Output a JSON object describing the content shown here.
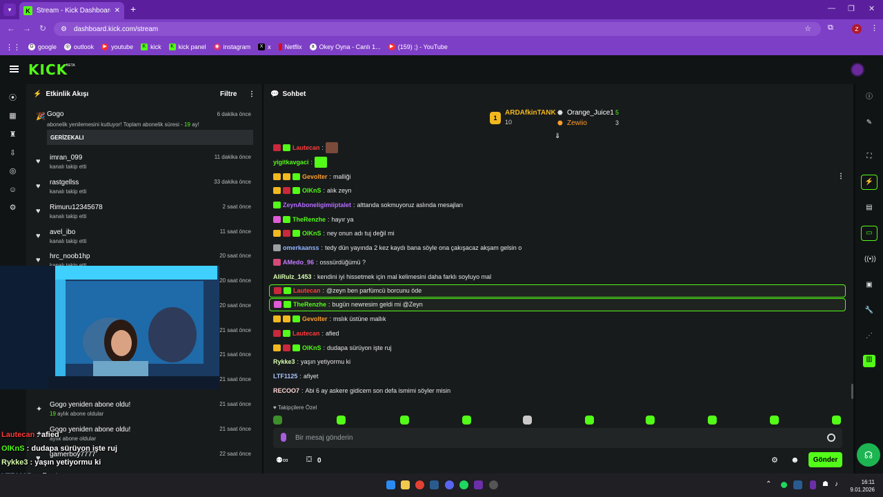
{
  "browser": {
    "tab_title": "Stream - Kick Dashboard",
    "url": "dashboard.kick.com/stream",
    "profile_initial": "Z",
    "bookmarks": [
      "google",
      "outlook",
      "youtube",
      "kick",
      "kick panel",
      "instagram",
      "x",
      "Netflix",
      "Okey Oyna - Canlı 1...",
      "(159) ;) - YouTube"
    ]
  },
  "kick": {
    "logo": "KICK",
    "beta": "BETA"
  },
  "feed": {
    "title": "Etkinlik Akışı",
    "filter": "Filtre",
    "sub_event": {
      "name": "Gogo",
      "time": "6 dakika önce",
      "text_pre": "abonelik yenilemesini kutluyor! Toplam abonelik süresi - ",
      "months": "19",
      "text_post": " ay!",
      "message": "GERİZEKALI"
    },
    "items": [
      {
        "name": "imran_099",
        "sub": "kanalı takip etti",
        "time": "11 dakika önce"
      },
      {
        "name": "rastgellss",
        "sub": "kanalı takip etti",
        "time": "33 dakika önce"
      },
      {
        "name": "Rimuru12345678",
        "sub": "kanalı takip etti",
        "time": "2 saat önce"
      },
      {
        "name": "avel_ibo",
        "sub": "kanalı takip etti",
        "time": "11 saat önce"
      },
      {
        "name": "hrc_noob1hp",
        "sub": "kanalı takip etti",
        "time": "20 saat önce"
      },
      {
        "name": "",
        "sub": "",
        "time": "20 saat önce"
      },
      {
        "name": "",
        "sub": "",
        "time": "20 saat önce"
      },
      {
        "name": "",
        "sub": "",
        "time": "21 saat önce"
      },
      {
        "name": "",
        "sub": "",
        "time": "21 saat önce"
      },
      {
        "name": "",
        "sub": "",
        "time": "21 saat önce"
      },
      {
        "name": "Gogo yeniden abone oldu!",
        "sub_num": "19",
        "sub": " aylık abone oldular",
        "time": "21 saat önce"
      },
      {
        "name": "Gogo yeniden abone oldu!",
        "sub": "aylık abone oldular",
        "time": "21 saat önce"
      },
      {
        "name": "gamerboy7777",
        "sub": "",
        "time": "22 saat önce"
      }
    ]
  },
  "overlay_chat": [
    {
      "user": "Lautecan",
      "text": ": afied",
      "color": "#ff3b3b"
    },
    {
      "user": "OlKnS",
      "text": ": dudapa sürüyon işte ruj",
      "color": "#53fc18"
    },
    {
      "user": "Rykke3",
      "text": ": yaşın yetiyormu ki",
      "color": "#d8ffb0"
    },
    {
      "user": "LTF1125",
      "text": ": afiyet",
      "color": "#a9c6ff"
    },
    {
      "user": "RECOO7",
      "text": ": Abi 6 ay askere gidicem son defa ismimi söyler misin",
      "color": "#ffd7d7"
    }
  ],
  "chat": {
    "title": "Sohbet",
    "leaderboard": {
      "first": {
        "name": "ARDAfkinTANK",
        "count": "10"
      },
      "second": {
        "name": "Orange_Juice1",
        "count": "5"
      },
      "third": {
        "name": "Zewiio",
        "count": "3"
      }
    },
    "messages": [
      {
        "user": "Lautecan",
        "text": "",
        "color": "#ff3b3b",
        "badges": [
          "#c9283d",
          "#53fc18"
        ],
        "hl": false
      },
      {
        "user": "yigitkavgaci",
        "text": "",
        "color": "#53fc18",
        "badges": [],
        "hl": false
      },
      {
        "user": "Gevolter",
        "text": "malliği",
        "color": "#ff9e2c",
        "badges": [
          "#f2b81f",
          "#f2b81f",
          "#53fc18"
        ],
        "hl": false
      },
      {
        "user": "OlKnS",
        "text": "alık zeyn",
        "color": "#53fc18",
        "badges": [
          "#f2b81f",
          "#c9283d",
          "#53fc18"
        ],
        "hl": false
      },
      {
        "user": "ZeynAboneligimiiptalet",
        "text": "alttanda sokmuyoruz aslında mesajları",
        "color": "#b46cff",
        "badges": [
          "#53fc18"
        ],
        "hl": false
      },
      {
        "user": "TheRenzhe",
        "text": "hayır ya",
        "color": "#53fc18",
        "badges": [
          "#e05bd6",
          "#53fc18"
        ],
        "hl": false
      },
      {
        "user": "OlKnS",
        "text": "ney onun adı tuj değil mi",
        "color": "#53fc18",
        "badges": [
          "#f2b81f",
          "#c9283d",
          "#53fc18"
        ],
        "hl": false
      },
      {
        "user": "omerkaanss",
        "text": "tedy dün yayında 2 kez kaydı bana söyle ona çakışacaz akşam gelsin o",
        "color": "#8fb4ff",
        "badges": [
          "#9aa0a3"
        ],
        "hl": false
      },
      {
        "user": "AMedo_96",
        "text": "osssürdüğümü ?",
        "color": "#c47bff",
        "badges": [
          "#d44a7a"
        ],
        "hl": false
      },
      {
        "user": "AliRulz_1453",
        "text": "kendini iyi hissetmek için mal kelimesini daha farklı soyluyo mal",
        "color": "#d8ffb0",
        "badges": [],
        "hl": false
      },
      {
        "user": "Lautecan",
        "text": "@zeyn ben parfümcü borcunu öde",
        "color": "#ff3b3b",
        "badges": [
          "#c9283d",
          "#53fc18"
        ],
        "hl": true
      },
      {
        "user": "TheRenzhe",
        "text": "bugün newresim geldi mi @Zeyn",
        "color": "#53fc18",
        "badges": [
          "#e05bd6",
          "#53fc18"
        ],
        "hl": true
      },
      {
        "user": "Gevolter",
        "text": "mslık üstüne mallık",
        "color": "#ff9e2c",
        "badges": [
          "#f2b81f",
          "#f2b81f",
          "#53fc18"
        ],
        "hl": false
      },
      {
        "user": "Lautecan",
        "text": "afied",
        "color": "#ff3b3b",
        "badges": [
          "#c9283d",
          "#53fc18"
        ],
        "hl": false
      },
      {
        "user": "OlKnS",
        "text": "dudapa sürüyon işte ruj",
        "color": "#53fc18",
        "badges": [
          "#f2b81f",
          "#c9283d",
          "#53fc18"
        ],
        "hl": false
      },
      {
        "user": "Rykke3",
        "text": "yaşın yetiyormu ki",
        "color": "#d8ffb0",
        "badges": [],
        "hl": false
      },
      {
        "user": "LTF1125",
        "text": "afiyet",
        "color": "#a9c6ff",
        "badges": [],
        "hl": false
      },
      {
        "user": "RECOO7",
        "text": "Abi 6 ay askere gidicem son defa ismimi söyler misin",
        "color": "#ffd7d7",
        "badges": [],
        "hl": false
      }
    ],
    "followers_only": "Takipçilere Özel",
    "input_placeholder": "Bir mesaj gönderin",
    "points": "0",
    "send": "Gönder"
  },
  "taskbar": {
    "time": "16:11",
    "date": "9.01.2026"
  },
  "colors": {
    "accent": "#53fc18",
    "browser": "#7e3fc7"
  }
}
